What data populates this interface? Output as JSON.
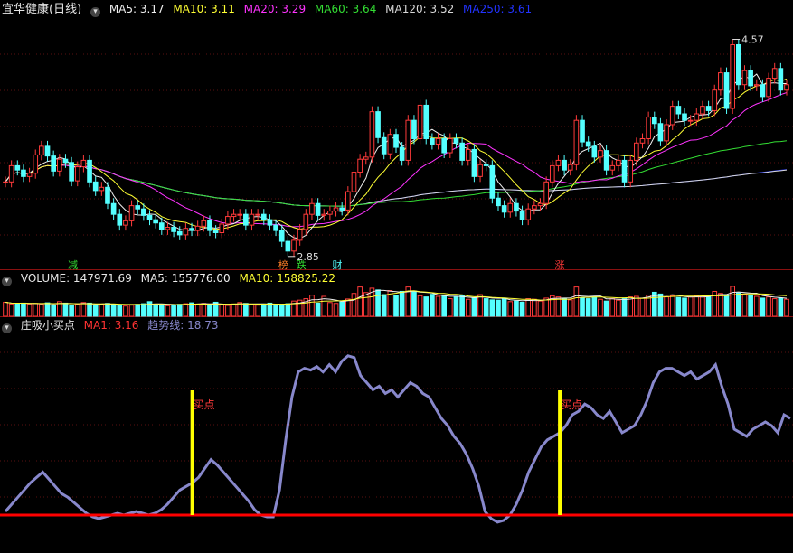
{
  "colors": {
    "up": "#ff3a3a",
    "down": "#54ffff",
    "ma5": "#f0f0f0",
    "ma10": "#ffff33",
    "ma20": "#ff33ff",
    "ma60": "#33dd33",
    "ma120": "#d8d8d8",
    "ma250": "#2233ff",
    "trend": "#8888cc",
    "ma1": "#ff0000",
    "signal": "#ffff00"
  },
  "price_header": {
    "title": "宜华健康(日线)",
    "ma5": "MA5: 3.17",
    "ma10": "MA10: 3.11",
    "ma20": "MA20: 3.29",
    "ma60": "MA60: 3.64",
    "ma120": "MA120: 3.52",
    "ma250": "MA250: 3.61"
  },
  "volume_header": {
    "volume": "VOLUME: 147971.69",
    "ma5": "MA5: 155776.00",
    "ma10": "MA10: 158825.22"
  },
  "indicator_header": {
    "name": "庄吸小买点",
    "ma1": "MA1: 3.16",
    "trend": "趋势线: 18.73"
  },
  "annotations": {
    "high": "4.57",
    "low": "2.85",
    "tags": [
      "减",
      "榜",
      "跌",
      "财",
      "涨"
    ],
    "buy": "买点"
  },
  "chart_data": [
    {
      "type": "candlestick",
      "name": "宜华健康(日线)",
      "ylim": [
        2.6,
        4.8
      ],
      "close": [
        3.3,
        3.45,
        3.41,
        3.35,
        3.38,
        3.55,
        3.63,
        3.54,
        3.4,
        3.51,
        3.48,
        3.31,
        3.44,
        3.5,
        3.3,
        3.22,
        3.25,
        3.1,
        3.0,
        2.9,
        2.94,
        3.08,
        3.05,
        2.99,
        2.95,
        2.92,
        2.86,
        2.88,
        2.84,
        2.81,
        2.87,
        2.85,
        2.89,
        2.94,
        2.85,
        2.83,
        2.91,
        2.98,
        3.0,
        3.0,
        2.9,
        3.0,
        3.0,
        2.95,
        2.9,
        2.85,
        2.75,
        2.66,
        2.76,
        2.86,
        3.0,
        3.1,
        2.99,
        3.0,
        3.03,
        3.06,
        3.04,
        3.21,
        3.39,
        3.51,
        3.53,
        3.95,
        3.71,
        3.56,
        3.74,
        3.62,
        3.5,
        3.87,
        3.7,
        4.01,
        3.7,
        3.65,
        3.7,
        3.57,
        3.7,
        3.66,
        3.5,
        3.6,
        3.35,
        3.46,
        3.45,
        3.15,
        3.08,
        3.02,
        3.1,
        3.03,
        2.95,
        3.05,
        3.08,
        3.1,
        3.3,
        3.45,
        3.5,
        3.41,
        3.46,
        3.87,
        3.67,
        3.63,
        3.53,
        3.59,
        3.41,
        3.45,
        3.5,
        3.3,
        3.5,
        3.66,
        3.7,
        3.9,
        3.84,
        3.68,
        3.83,
        4.0,
        3.93,
        3.87,
        3.87,
        3.93,
        4.0,
        3.96,
        4.15,
        4.31,
        3.98,
        4.57,
        4.2,
        4.33,
        4.19,
        4.2,
        4.09,
        4.26,
        4.35,
        4.15,
        4.2
      ],
      "volume": [
        0.48,
        0.42,
        0.44,
        0.45,
        0.42,
        0.44,
        0.4,
        0.46,
        0.38,
        0.5,
        0.45,
        0.38,
        0.4,
        0.47,
        0.45,
        0.38,
        0.4,
        0.44,
        0.37,
        0.4,
        0.35,
        0.38,
        0.41,
        0.43,
        0.5,
        0.4,
        0.38,
        0.36,
        0.38,
        0.41,
        0.43,
        0.46,
        0.42,
        0.44,
        0.36,
        0.48,
        0.4,
        0.37,
        0.42,
        0.47,
        0.44,
        0.4,
        0.38,
        0.42,
        0.45,
        0.41,
        0.38,
        0.43,
        0.52,
        0.55,
        0.6,
        0.72,
        0.45,
        0.68,
        0.47,
        0.44,
        0.49,
        0.59,
        0.78,
        1.0,
        0.81,
        0.96,
        0.9,
        0.74,
        0.88,
        0.72,
        0.85,
        1.0,
        0.86,
        0.7,
        0.66,
        0.75,
        0.68,
        0.72,
        0.6,
        0.66,
        0.7,
        0.58,
        0.62,
        0.74,
        0.6,
        0.56,
        0.55,
        0.62,
        0.5,
        0.52,
        0.48,
        0.6,
        0.58,
        0.52,
        0.62,
        0.7,
        0.66,
        0.6,
        0.56,
        1.0,
        0.62,
        0.6,
        0.66,
        0.58,
        0.52,
        0.6,
        0.55,
        0.6,
        0.66,
        0.68,
        0.62,
        0.72,
        0.82,
        0.76,
        0.66,
        0.7,
        0.64,
        0.62,
        0.66,
        0.7,
        0.66,
        0.72,
        0.85,
        0.78,
        0.7,
        1.02,
        0.8,
        0.74,
        0.7,
        0.68,
        0.62,
        0.66,
        0.6,
        0.62,
        0.58
      ]
    },
    {
      "type": "line",
      "name": "庄吸小买点",
      "ylim": [
        0,
        100
      ],
      "ma1_level": 3.16,
      "trend": [
        2,
        6,
        10,
        14,
        18,
        21,
        24,
        20,
        16,
        12,
        10,
        7,
        4,
        1,
        -1,
        -2,
        -1,
        0,
        1,
        0,
        1,
        2,
        1,
        0,
        1,
        3,
        6,
        10,
        14,
        16,
        18,
        21,
        26,
        31,
        28,
        24,
        20,
        16,
        12,
        8,
        3,
        0,
        -1,
        -1,
        14,
        42,
        66,
        80,
        82,
        81,
        83,
        80,
        84,
        80,
        86,
        89,
        88,
        78,
        74,
        70,
        72,
        68,
        70,
        66,
        70,
        74,
        72,
        68,
        66,
        60,
        54,
        50,
        44,
        40,
        34,
        26,
        16,
        2,
        -2,
        -4,
        -3,
        0,
        6,
        14,
        24,
        31,
        38,
        42,
        44,
        46,
        50,
        56,
        58,
        62,
        60,
        56,
        54,
        58,
        52,
        46,
        48,
        50,
        56,
        64,
        74,
        80,
        82,
        82,
        80,
        78,
        80,
        76,
        78,
        80,
        84,
        72,
        62,
        48,
        46,
        44,
        48,
        50,
        52,
        50,
        46,
        56,
        54
      ]
    }
  ]
}
